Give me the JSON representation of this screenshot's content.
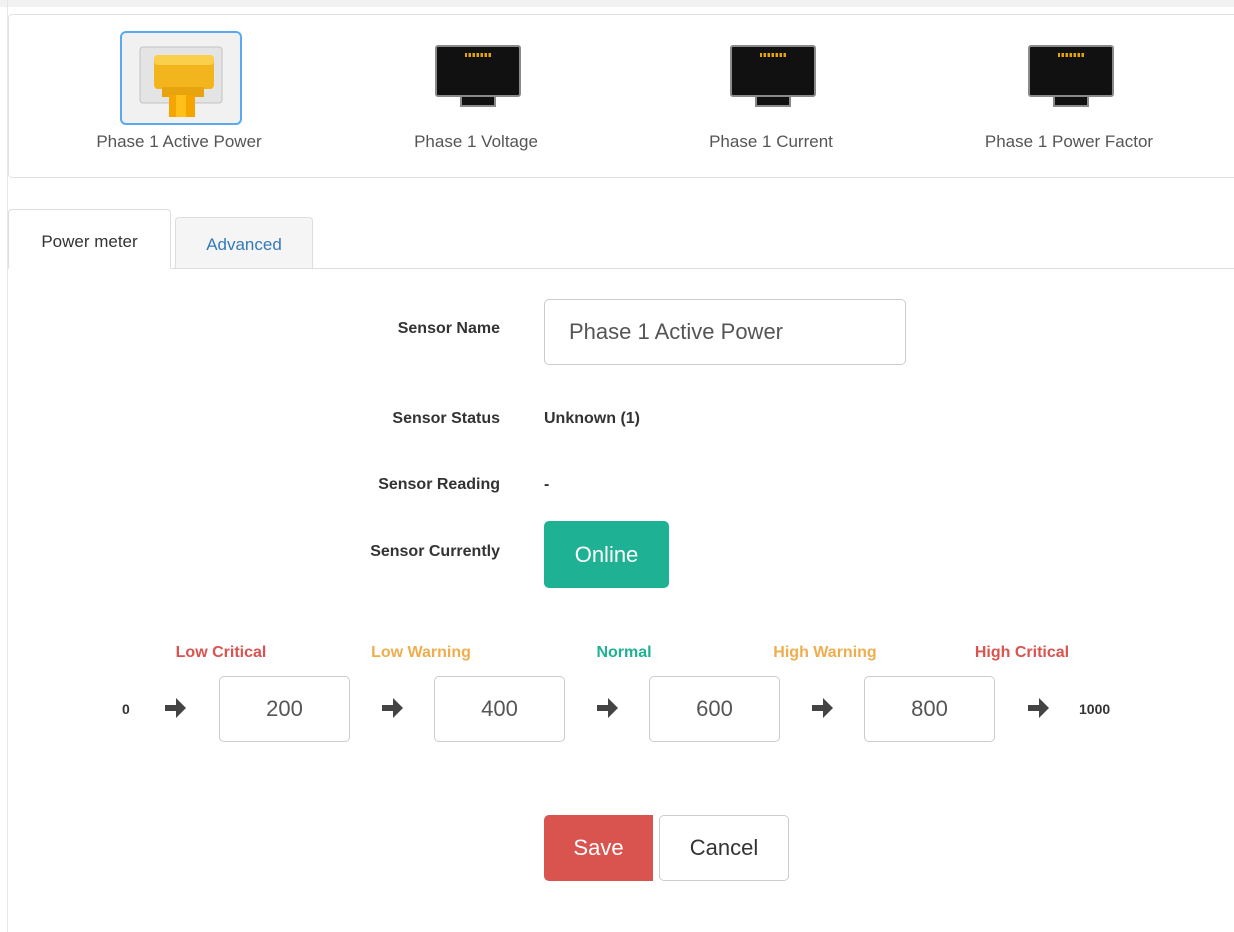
{
  "sensors": [
    {
      "label": "Phase 1 Active Power",
      "icon": "ethernet-port-connected-icon",
      "selected": true
    },
    {
      "label": "Phase 1 Voltage",
      "icon": "ethernet-port-icon",
      "selected": false
    },
    {
      "label": "Phase 1 Current",
      "icon": "ethernet-port-icon",
      "selected": false
    },
    {
      "label": "Phase 1 Power Factor",
      "icon": "ethernet-port-icon",
      "selected": false
    }
  ],
  "tabs": [
    {
      "label": "Power meter",
      "active": true
    },
    {
      "label": "Advanced",
      "active": false
    }
  ],
  "form": {
    "name_label": "Sensor Name",
    "name_value": "Phase 1 Active Power",
    "status_label": "Sensor Status",
    "status_value": "Unknown (1)",
    "reading_label": "Sensor Reading",
    "reading_value": "-",
    "currently_label": "Sensor Currently",
    "currently_button": "Online"
  },
  "thresholds": {
    "labels": [
      {
        "text": "Low Critical",
        "color": "#d9534f"
      },
      {
        "text": "Low Warning",
        "color": "#f0ad4e"
      },
      {
        "text": "Normal",
        "color": "#1fb193"
      },
      {
        "text": "High Warning",
        "color": "#f0ad4e"
      },
      {
        "text": "High Critical",
        "color": "#d9534f"
      }
    ],
    "min": "0",
    "max": "1000",
    "values": [
      "200",
      "400",
      "600",
      "800"
    ]
  },
  "actions": {
    "save": "Save",
    "cancel": "Cancel"
  },
  "colors": {
    "selected_border": "#5aa9ee",
    "online": "#1fb193",
    "save": "#d9534f",
    "link": "#337ab7"
  }
}
